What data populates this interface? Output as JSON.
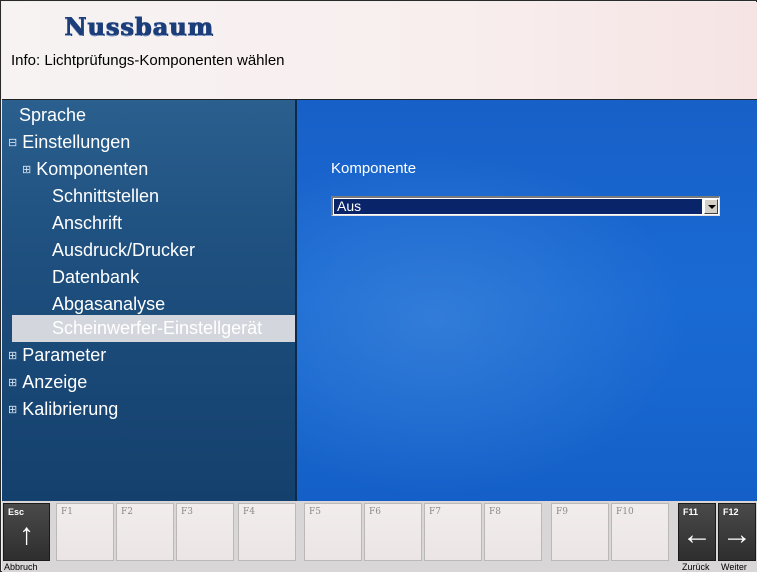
{
  "header": {
    "logo": "Nussbaum",
    "info": "Info: Lichtprüfungs-Komponenten wählen"
  },
  "sidebar": {
    "items": [
      {
        "label": "Sprache",
        "expander": ""
      },
      {
        "label": "Einstellungen",
        "expander": "⊟"
      },
      {
        "label": "Komponenten",
        "expander": "⊞"
      },
      {
        "label": "Schnittstellen",
        "expander": ""
      },
      {
        "label": "Anschrift",
        "expander": ""
      },
      {
        "label": "Ausdruck/Drucker",
        "expander": ""
      },
      {
        "label": "Datenbank",
        "expander": ""
      },
      {
        "label": "Abgasanalyse",
        "expander": ""
      },
      {
        "label": "Scheinwerfer-Einstellgerät",
        "expander": ""
      },
      {
        "label": "Parameter",
        "expander": "⊞"
      },
      {
        "label": "Anzeige",
        "expander": "⊞"
      },
      {
        "label": "Kalibrierung",
        "expander": "⊞"
      }
    ],
    "selected_index": 8
  },
  "main": {
    "component_label": "Komponente",
    "component_value": "Aus"
  },
  "fkeys": {
    "esc": {
      "label": "Esc",
      "caption": "Abbruch",
      "icon": "arrow-up-icon"
    },
    "f1": "F1",
    "f2": "F2",
    "f3": "F3",
    "f4": "F4",
    "f5": "F5",
    "f6": "F6",
    "f7": "F7",
    "f8": "F8",
    "f9": "F9",
    "f10": "F10",
    "f11": {
      "label": "F11",
      "caption": "Zurück",
      "icon": "arrow-left-icon"
    },
    "f12": {
      "label": "F12",
      "caption": "Weiter",
      "icon": "arrow-right-icon"
    }
  },
  "colors": {
    "sidebar_bg": "#1e4f7e",
    "main_bg": "#1a6ad4",
    "selection_bg": "#0a246a",
    "tree_selected_bg": "#d3d6dc",
    "logo": "#1b3e7a"
  }
}
